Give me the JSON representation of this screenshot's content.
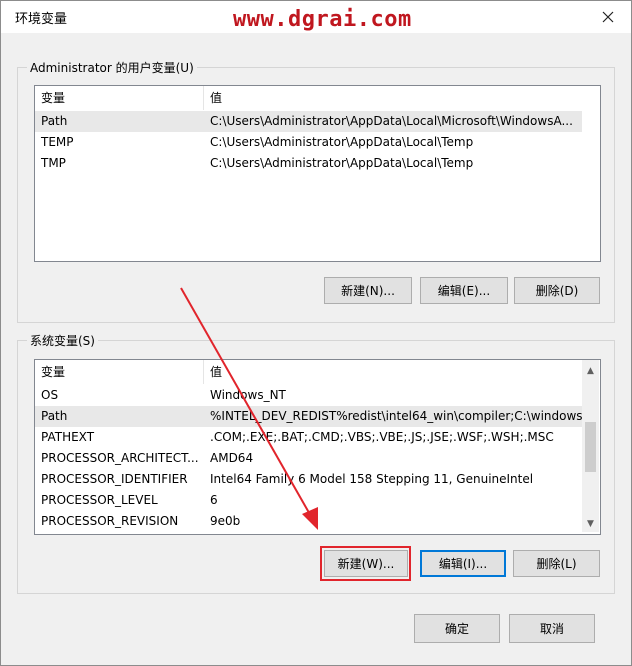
{
  "window": {
    "title": "环境变量",
    "watermark": "www.dgrai.com"
  },
  "user_vars": {
    "group_label": "Administrator 的用户变量(U)",
    "headers": [
      "变量",
      "值"
    ],
    "rows": [
      {
        "name": "Path",
        "value": "C:\\Users\\Administrator\\AppData\\Local\\Microsoft\\WindowsA..."
      },
      {
        "name": "TEMP",
        "value": "C:\\Users\\Administrator\\AppData\\Local\\Temp"
      },
      {
        "name": "TMP",
        "value": "C:\\Users\\Administrator\\AppData\\Local\\Temp"
      }
    ],
    "buttons": {
      "new": "新建(N)...",
      "edit": "编辑(E)...",
      "delete": "删除(D)"
    }
  },
  "system_vars": {
    "group_label": "系统变量(S)",
    "headers": [
      "变量",
      "值"
    ],
    "rows": [
      {
        "name": "OS",
        "value": "Windows_NT"
      },
      {
        "name": "Path",
        "value": "%INTEL_DEV_REDIST%redist\\intel64_win\\compiler;C:\\windows..."
      },
      {
        "name": "PATHEXT",
        "value": ".COM;.EXE;.BAT;.CMD;.VBS;.VBE;.JS;.JSE;.WSF;.WSH;.MSC"
      },
      {
        "name": "PROCESSOR_ARCHITECT...",
        "value": "AMD64"
      },
      {
        "name": "PROCESSOR_IDENTIFIER",
        "value": "Intel64 Family 6 Model 158 Stepping 11, GenuineIntel"
      },
      {
        "name": "PROCESSOR_LEVEL",
        "value": "6"
      },
      {
        "name": "PROCESSOR_REVISION",
        "value": "9e0b"
      }
    ],
    "buttons": {
      "new": "新建(W)...",
      "edit": "编辑(I)...",
      "delete": "删除(L)"
    }
  },
  "footer": {
    "ok": "确定",
    "cancel": "取消"
  },
  "colors": {
    "accent": "#0078d7",
    "highlight": "#e1252c",
    "watermark": "#c0171f"
  }
}
